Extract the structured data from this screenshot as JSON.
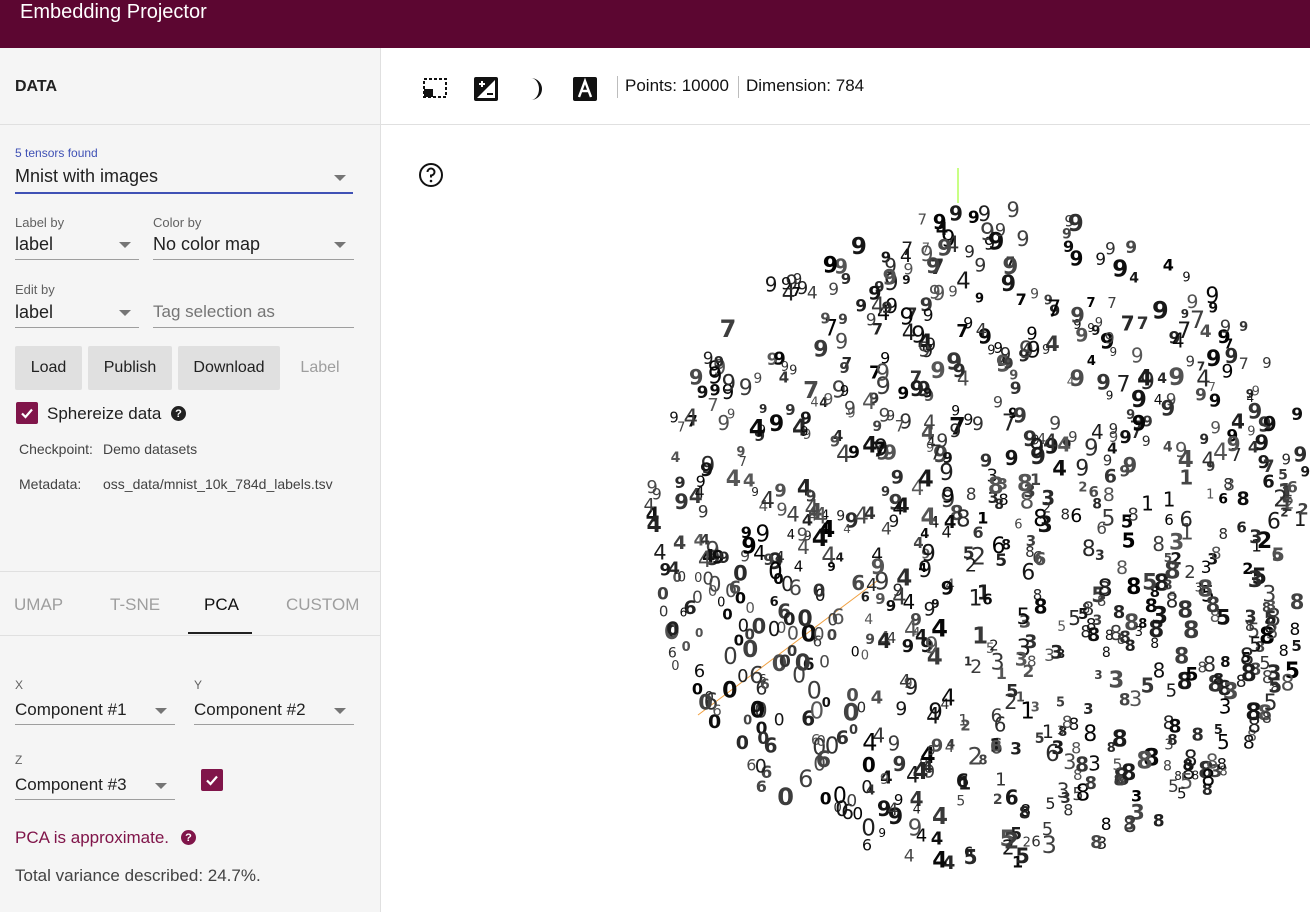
{
  "app": {
    "title": "Embedding Projector"
  },
  "data_panel": {
    "title": "DATA",
    "tensors_found": "5 tensors found",
    "dataset": "Mnist with images",
    "label_by": {
      "label": "Label by",
      "value": "label"
    },
    "color_by": {
      "label": "Color by",
      "value": "No color map"
    },
    "edit_by": {
      "label": "Edit by",
      "value": "label"
    },
    "tag_selection_placeholder": "Tag selection as",
    "buttons": {
      "load": "Load",
      "publish": "Publish",
      "download": "Download",
      "label": "Label"
    },
    "sphereize": {
      "label": "Sphereize data",
      "checked": true
    },
    "checkpoint": {
      "key": "Checkpoint:",
      "value": "Demo datasets"
    },
    "metadata": {
      "key": "Metadata:",
      "value": "oss_data/mnist_10k_784d_labels.tsv"
    }
  },
  "projection_tabs": {
    "items": [
      "UMAP",
      "T-SNE",
      "PCA",
      "CUSTOM"
    ],
    "active": "PCA"
  },
  "pca": {
    "x": {
      "label": "X",
      "value": "Component #1"
    },
    "y": {
      "label": "Y",
      "value": "Component #2"
    },
    "z": {
      "label": "Z",
      "value": "Component #3",
      "enabled": true
    },
    "approx_text": "PCA is approximate.",
    "variance_text": "Total variance described: 24.7%."
  },
  "toolbar": {
    "icons": [
      "select-rectangle-icon",
      "night-mode-icon",
      "labels-3d-icon",
      "text-label-icon"
    ],
    "points_text": "Points: 10000",
    "dimension_text": "Dimension: 784"
  },
  "colors": {
    "topbar": "#5c0631",
    "accent": "#80154a",
    "accent_text": "#80154a",
    "link_blue": "#3f51b5"
  }
}
